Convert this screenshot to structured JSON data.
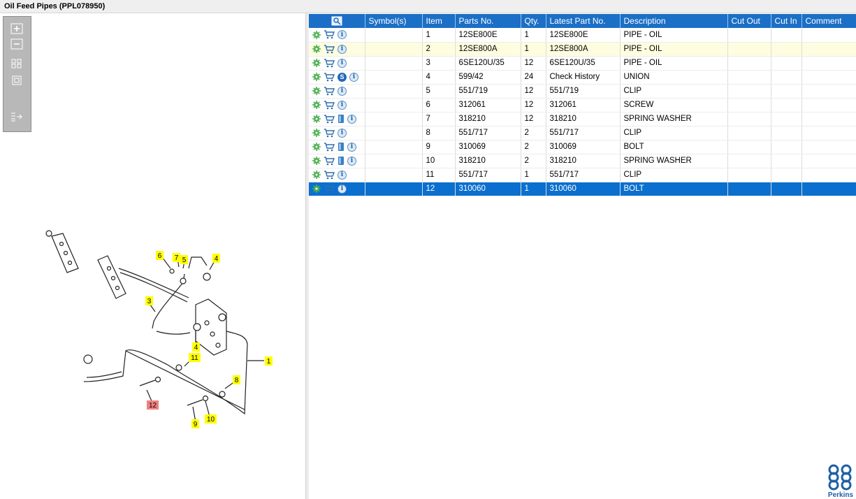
{
  "window": {
    "title": "Oil Feed Pipes (PPL078950)"
  },
  "toolbar": {
    "buttons": [
      "zoom-in-icon",
      "zoom-out-icon",
      "fit-grid-icon",
      "actual-size-icon",
      "export-list-icon"
    ]
  },
  "table": {
    "columns": [
      "",
      "Symbol(s)",
      "Item",
      "Parts No.",
      "Qty.",
      "Latest Part No.",
      "Description",
      "Cut Out",
      "Cut In",
      "Comment"
    ],
    "rows": [
      {
        "icons": [
          "gear-icon",
          "cart-icon",
          "info-icon"
        ],
        "symbols": "",
        "item": "1",
        "part": "12SE800E",
        "qty": "1",
        "latest": "12SE800E",
        "desc": "PIPE - OIL",
        "cut_out": "",
        "cut_in": "",
        "comment": ""
      },
      {
        "icons": [
          "gear-icon",
          "cart-icon",
          "info-icon"
        ],
        "symbols": "",
        "item": "2",
        "part": "12SE800A",
        "qty": "1",
        "latest": "12SE800A",
        "desc": "PIPE - OIL",
        "cut_out": "",
        "cut_in": "",
        "comment": ""
      },
      {
        "icons": [
          "gear-icon",
          "cart-icon",
          "info-icon"
        ],
        "symbols": "",
        "item": "3",
        "part": "6SE120U/35",
        "qty": "12",
        "latest": "6SE120U/35",
        "desc": "PIPE - OIL",
        "cut_out": "",
        "cut_in": "",
        "comment": ""
      },
      {
        "icons": [
          "gear-icon",
          "cart-icon",
          "s-badge-icon",
          "info-icon"
        ],
        "symbols": "",
        "item": "4",
        "part": "599/42",
        "qty": "24",
        "latest": "Check History",
        "desc": "UNION",
        "cut_out": "",
        "cut_in": "",
        "comment": ""
      },
      {
        "icons": [
          "gear-icon",
          "cart-icon",
          "info-icon"
        ],
        "symbols": "",
        "item": "5",
        "part": "551/719",
        "qty": "12",
        "latest": "551/719",
        "desc": "CLIP",
        "cut_out": "",
        "cut_in": "",
        "comment": ""
      },
      {
        "icons": [
          "gear-icon",
          "cart-icon",
          "info-icon"
        ],
        "symbols": "",
        "item": "6",
        "part": "312061",
        "qty": "12",
        "latest": "312061",
        "desc": "SCREW",
        "cut_out": "",
        "cut_in": "",
        "comment": ""
      },
      {
        "icons": [
          "gear-icon",
          "cart-icon",
          "book-icon",
          "info-icon"
        ],
        "symbols": "",
        "item": "7",
        "part": "318210",
        "qty": "12",
        "latest": "318210",
        "desc": "SPRING WASHER",
        "cut_out": "",
        "cut_in": "",
        "comment": ""
      },
      {
        "icons": [
          "gear-icon",
          "cart-icon",
          "info-icon"
        ],
        "symbols": "",
        "item": "8",
        "part": "551/717",
        "qty": "2",
        "latest": "551/717",
        "desc": "CLIP",
        "cut_out": "",
        "cut_in": "",
        "comment": ""
      },
      {
        "icons": [
          "gear-icon",
          "cart-icon",
          "book-icon",
          "info-icon"
        ],
        "symbols": "",
        "item": "9",
        "part": "310069",
        "qty": "2",
        "latest": "310069",
        "desc": "BOLT",
        "cut_out": "",
        "cut_in": "",
        "comment": ""
      },
      {
        "icons": [
          "gear-icon",
          "cart-icon",
          "book-icon",
          "info-icon"
        ],
        "symbols": "",
        "item": "10",
        "part": "318210",
        "qty": "2",
        "latest": "318210",
        "desc": "SPRING WASHER",
        "cut_out": "",
        "cut_in": "",
        "comment": ""
      },
      {
        "icons": [
          "gear-icon",
          "cart-icon",
          "info-icon"
        ],
        "symbols": "",
        "item": "11",
        "part": "551/717",
        "qty": "1",
        "latest": "551/717",
        "desc": "CLIP",
        "cut_out": "",
        "cut_in": "",
        "comment": ""
      },
      {
        "icons": [
          "gear-icon",
          "cart-icon",
          "info-icon"
        ],
        "symbols": "",
        "item": "12",
        "part": "310060",
        "qty": "1",
        "latest": "310060",
        "desc": "BOLT",
        "cut_out": "",
        "cut_in": "",
        "comment": ""
      }
    ],
    "highlighted_row_item": "2",
    "selected_row_item": "12"
  },
  "diagram": {
    "callouts": [
      "1",
      "3",
      "4",
      "4",
      "5",
      "6",
      "7",
      "8",
      "9",
      "10",
      "11",
      "12"
    ],
    "highlighted_callout": "12",
    "callout_color": "#ffff00",
    "highlight_color": "#f08080"
  },
  "brand": {
    "name": "Perkins",
    "color": "#1f5fa6"
  },
  "colors": {
    "header": "#1b6fc6",
    "selected": "#0a6fcf",
    "alt_row": "#fffde0",
    "gear": "#4caf50"
  }
}
